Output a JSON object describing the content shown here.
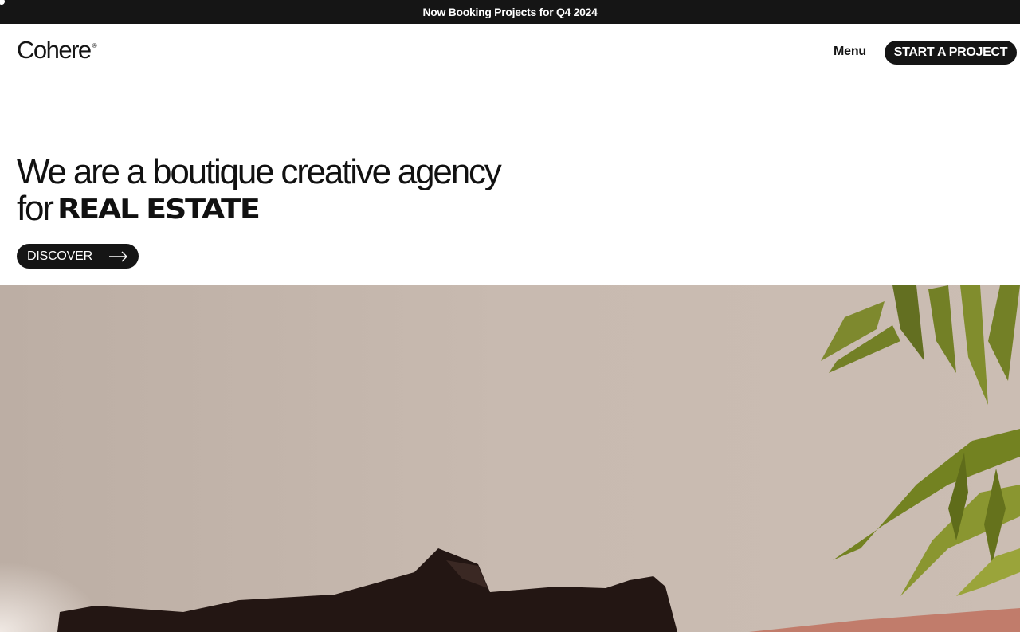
{
  "announcement": {
    "text": "Now Booking Projects for Q4 2024"
  },
  "header": {
    "logo_text": "Cohere",
    "logo_mark": "®",
    "menu_label": "Menu",
    "cta_label": "START A PROJECT"
  },
  "hero": {
    "title_line1": "We are a boutique creative agency",
    "title_line2_prefix": "for",
    "title_line2_emphasis": "REAL ESTATE",
    "discover_label": "DISCOVER",
    "discover_icon": "arrow-right-icon",
    "image_subject": "interior-photo"
  },
  "colors": {
    "dark": "#151515",
    "white": "#ffffff",
    "wall": "#c4b6ac",
    "plant": "#6b7a1e",
    "sofa": "#c07a68"
  }
}
